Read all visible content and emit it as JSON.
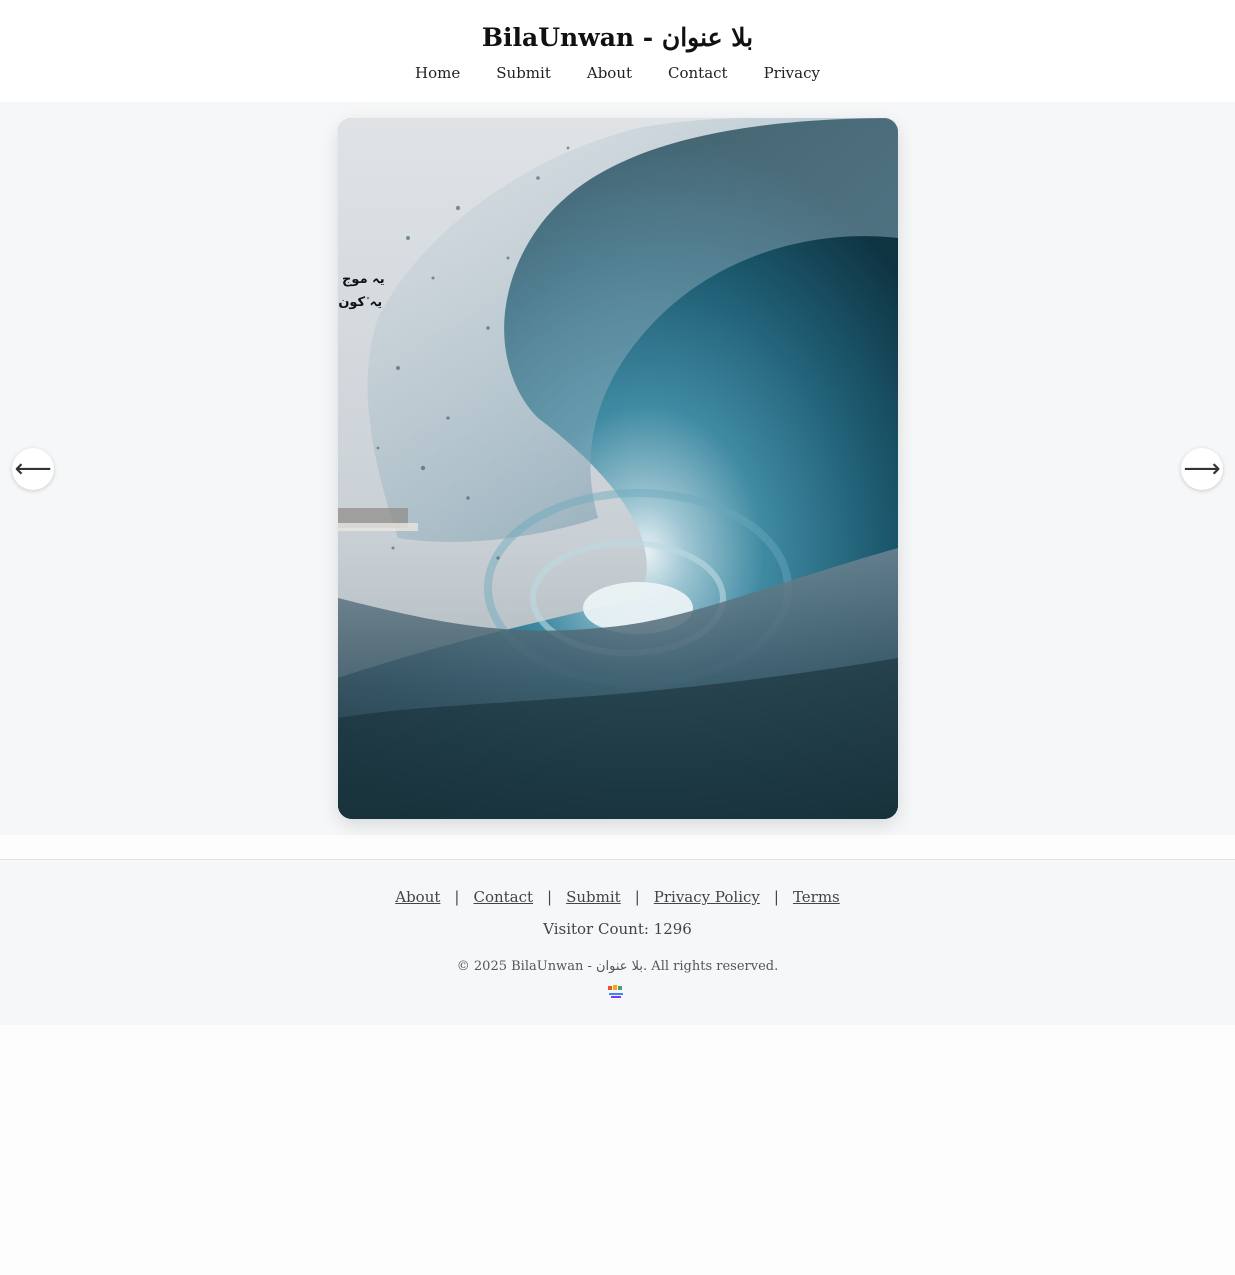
{
  "site": {
    "title": "BilaUnwan - بلا عنوان"
  },
  "nav": {
    "items": [
      "Home",
      "Submit",
      "About",
      "Contact",
      "Privacy"
    ]
  },
  "slider": {
    "overlay_lines": [
      "یہ موج م",
      "یہ کون ڈ"
    ],
    "prev_icon": "arrow-left-icon",
    "next_icon": "arrow-right-icon",
    "prev_glyph": "⟵",
    "next_glyph": "⟶"
  },
  "footer": {
    "links": [
      "About",
      "Contact",
      "Submit",
      "Privacy Policy",
      "Terms"
    ],
    "separator": "|",
    "visitor_text": "Visitor Count: 1296",
    "copyright": "© 2025 BilaUnwan - بلا عنوان. All rights reserved.",
    "logo_icon": "site-logo-icon"
  },
  "colors": {
    "header_bg": "#ffffff",
    "main_bg": "#f6f7f8",
    "wave_dark": "#0f3a4a",
    "wave_mid": "#2a6f86",
    "sky": "#d9dee2"
  }
}
